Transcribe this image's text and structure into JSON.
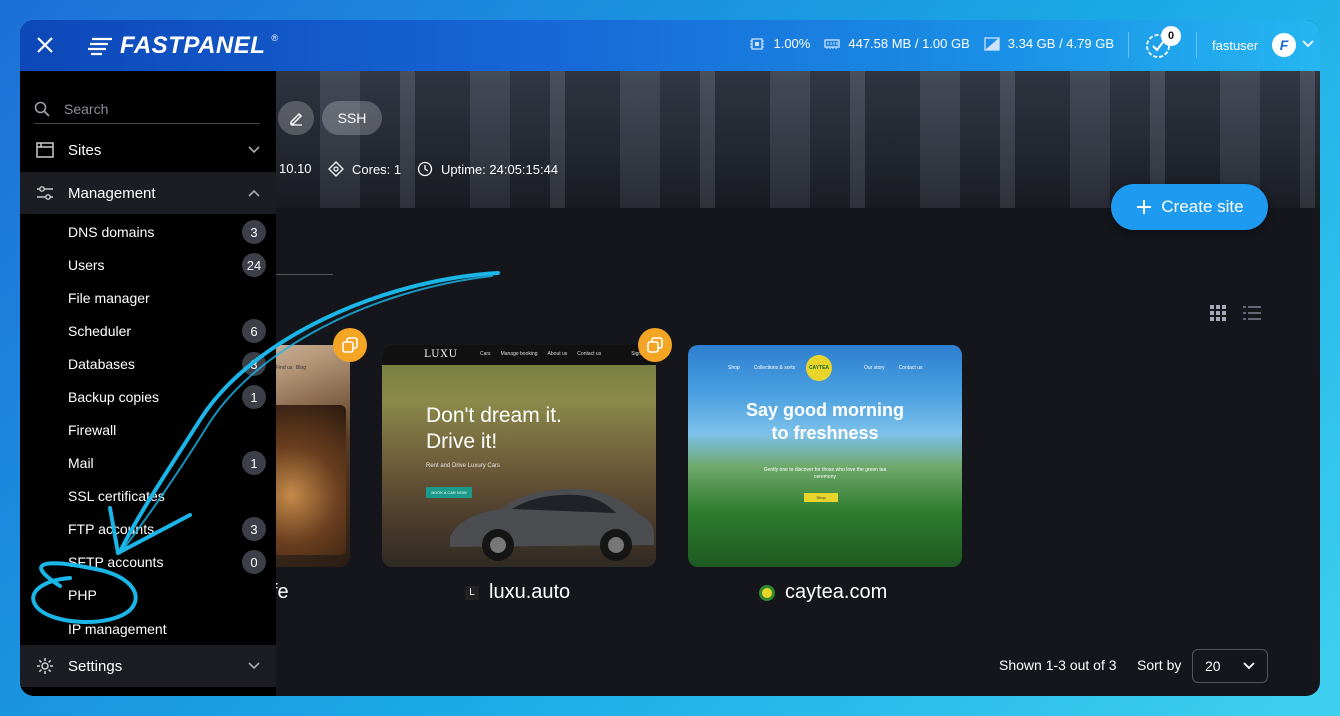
{
  "topbar": {
    "logo": "FASTPANEL",
    "logo_reg": "®",
    "cpu": "1.00%",
    "ram": "447.58 MB / 1.00 GB",
    "disk": "3.34 GB / 4.79 GB",
    "tasks_count": "0",
    "user": "fastuser",
    "avatar_letter": "F"
  },
  "hero": {
    "ssh_label": "SSH",
    "ip_fragment": "10.10",
    "cores": "Cores: 1",
    "uptime": "Uptime: 24:05:15:44",
    "create_site": "Create site"
  },
  "sidebar": {
    "search_placeholder": "Search",
    "sites": "Sites",
    "management": "Management",
    "items": [
      {
        "label": "DNS domains",
        "count": "3"
      },
      {
        "label": "Users",
        "count": "24"
      },
      {
        "label": "File manager",
        "count": ""
      },
      {
        "label": "Scheduler",
        "count": "6"
      },
      {
        "label": "Databases",
        "count": "3"
      },
      {
        "label": "Backup copies",
        "count": "1"
      },
      {
        "label": "Firewall",
        "count": ""
      },
      {
        "label": "Mail",
        "count": "1"
      },
      {
        "label": "SSL certificates",
        "count": ""
      },
      {
        "label": "FTP accounts",
        "count": "3"
      },
      {
        "label": "SFTP accounts",
        "count": "0"
      },
      {
        "label": "PHP",
        "count": ""
      },
      {
        "label": "IP management",
        "count": ""
      }
    ],
    "settings": "Settings"
  },
  "sites": [
    {
      "name": "fe",
      "preview_nav": [
        "Find us",
        "Blog"
      ]
    },
    {
      "name": "luxu.auto",
      "headline1": "Don't dream it.",
      "headline2": "Drive it!",
      "sub": "Rent and Drive Luxury Cars",
      "cta": "BOOK A CAR NOW",
      "brand": "LUXU",
      "nav": [
        "Cars",
        "Manage booking",
        "About us",
        "Contact us",
        "Sign in"
      ]
    },
    {
      "name": "caytea.com",
      "headline1": "Say good morning",
      "headline2": "to freshness",
      "brand": "CAYTEA",
      "nav": [
        "Shop",
        "Collections & sorts",
        "Our story",
        "Contact us"
      ],
      "sub": "Gently one to discover for those who love the green tea ceremony",
      "cta": "Shop"
    }
  ],
  "footer": {
    "shown": "Shown 1-3 out of 3",
    "sort_by": "Sort by",
    "per_page": "20"
  },
  "colors": {
    "accent": "#1e9bf0",
    "badge": "#f5a524",
    "annotation": "#1ab6e8"
  }
}
